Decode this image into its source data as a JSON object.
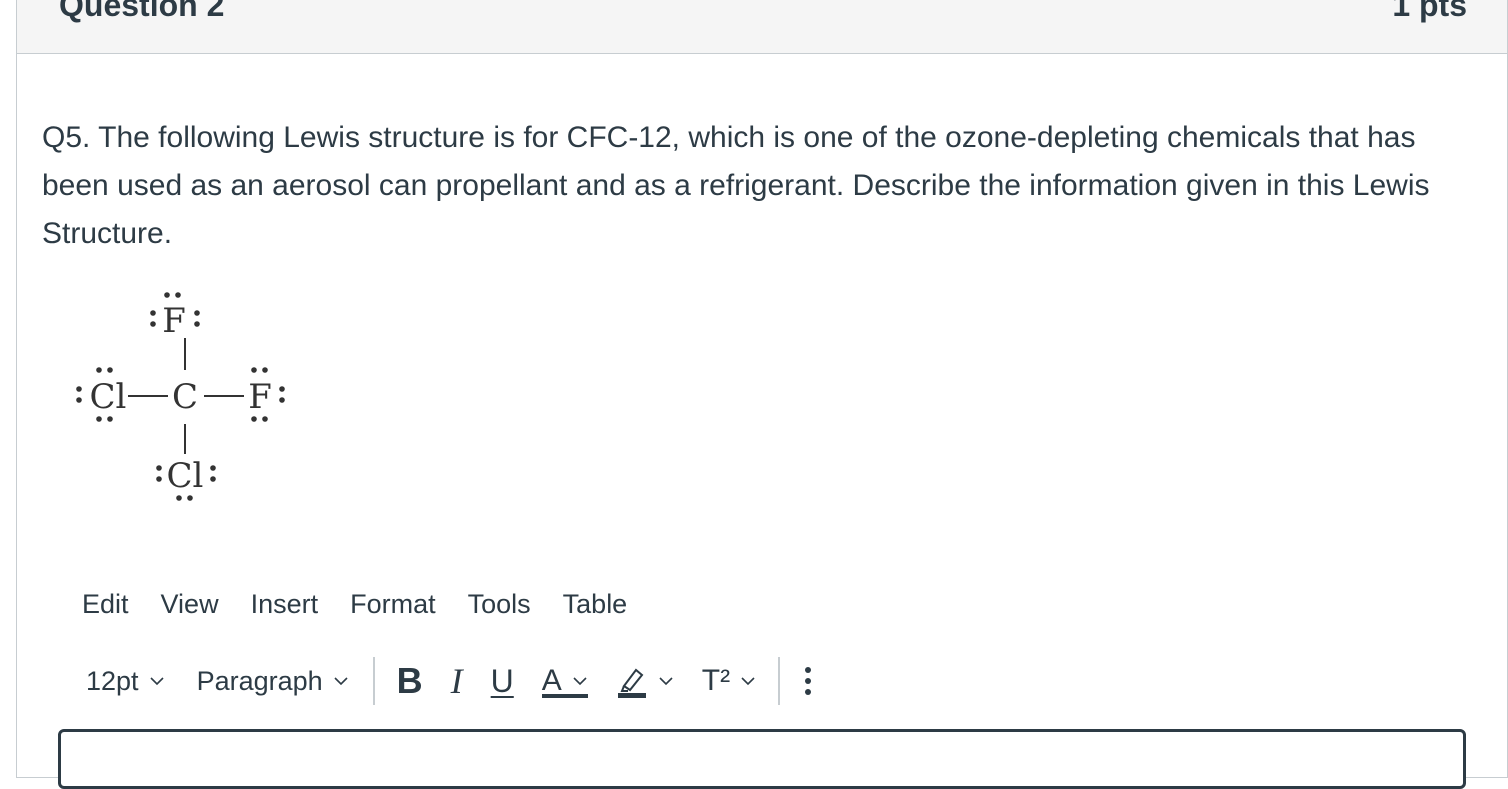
{
  "question": {
    "title": "Question 2",
    "points": "1 pts",
    "text": "Q5.  The following Lewis structure is for CFC-12, which is one of the ozone-depleting chemicals that has been used as an aerosol can propellant and as a refrigerant.  Describe the information given in this Lewis Structure."
  },
  "lewis_structure": {
    "center": "C",
    "top": "F",
    "left": "Cl",
    "right": "F",
    "bottom": "Cl"
  },
  "editor": {
    "menu": [
      "Edit",
      "View",
      "Insert",
      "Format",
      "Tools",
      "Table"
    ],
    "font_size": "12pt",
    "block_format": "Paragraph",
    "bold_label": "B",
    "italic_label": "I",
    "underline_label": "U",
    "text_color_label": "A",
    "superscript_label": "T²"
  }
}
